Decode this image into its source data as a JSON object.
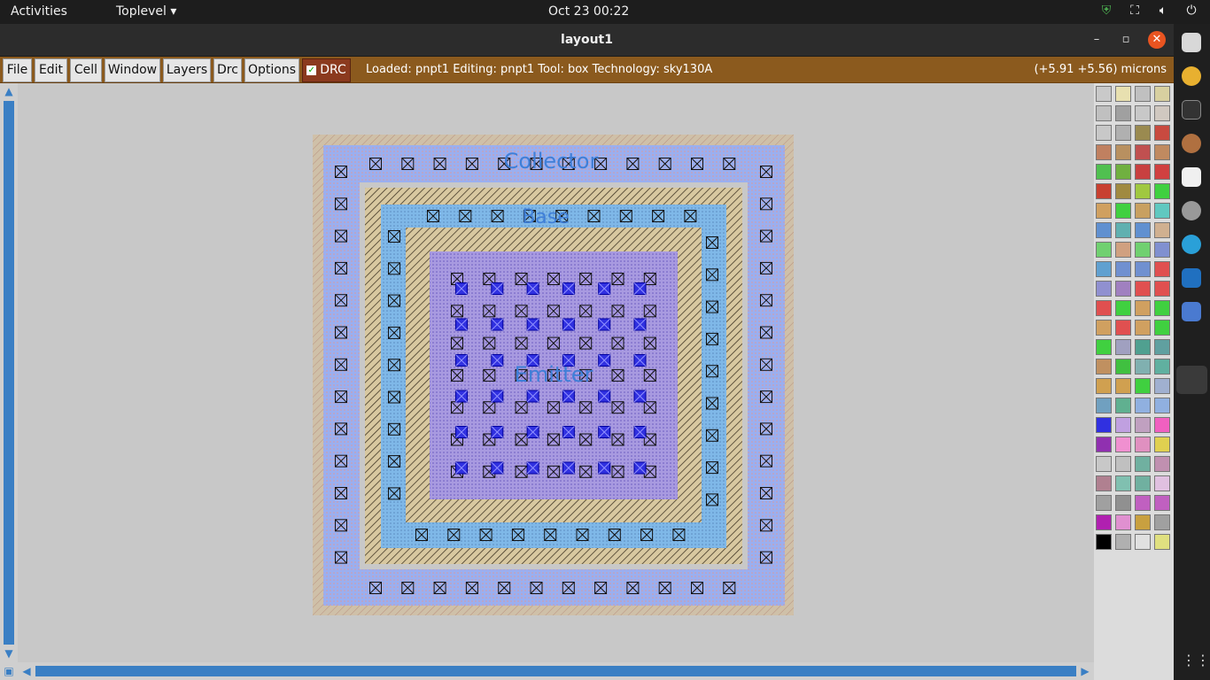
{
  "topbar": {
    "activities": "Activities",
    "app_menu": "Toplevel ▾",
    "clock": "Oct 23  00:22"
  },
  "window": {
    "title": "layout1"
  },
  "menubar": {
    "items": [
      "File",
      "Edit",
      "Cell",
      "Window",
      "Layers",
      "Drc",
      "Options"
    ],
    "drc_toggle": "DRC",
    "drc_checked": true,
    "status": "Loaded: pnpt1 Editing: pnpt1 Tool: box  Technology: sky130A",
    "coords": "(+5.91 +5.56) microns"
  },
  "layout": {
    "labels": {
      "collector": "Collector",
      "base": "Base",
      "emitter": "Emitter"
    },
    "colors": {
      "background": "#c8c8c8",
      "nwell_fill": "#9aaff0",
      "base_ring": "#7fb8e8",
      "hatch": "#a08a5a",
      "emitter_fill": "#a89ae0",
      "contact_blue": "#1010d0",
      "label_text": "#3f7fd8"
    }
  },
  "palette": {
    "colors": [
      "#c9c9c9",
      "#e8e0b0",
      "#c0c0c0",
      "#d8d0a0",
      "#c0c0c0",
      "#a0a0a0",
      "#c8c8c8",
      "#d0c8c0",
      "#c8c8c8",
      "#b0b0b0",
      "#9a8a50",
      "#c84a40",
      "#c08060",
      "#b89060",
      "#c05050",
      "#c08a60",
      "#50c050",
      "#70b040",
      "#c84040",
      "#d04040",
      "#c84030",
      "#a08a40",
      "#a0c840",
      "#40d040",
      "#d0a060",
      "#40d040",
      "#c8a060",
      "#60c8c0",
      "#6090d0",
      "#60b0b0",
      "#6090d0",
      "#d0b090",
      "#70d070",
      "#d0a080",
      "#70d070",
      "#8090d0",
      "#60a0d0",
      "#7090d0",
      "#7090d0",
      "#e05050",
      "#9090d0",
      "#a080c0",
      "#e05050",
      "#e05050",
      "#e05050",
      "#40d040",
      "#d0a060",
      "#40d040",
      "#d0a060",
      "#e05050",
      "#d0a060",
      "#40d040",
      "#40d040",
      "#a0a0c0",
      "#50a090",
      "#60a0a0",
      "#c09060",
      "#40c040",
      "#80b0b0",
      "#60b0a0",
      "#d0a050",
      "#d0a050",
      "#40d040",
      "#a0b0d0",
      "#70a0c0",
      "#60b090",
      "#90b0e0",
      "#90b0e0",
      "#3030e0",
      "#c0a0e0",
      "#c0a0c0",
      "#f060c0",
      "#9030b0",
      "#f090d0",
      "#e090c0",
      "#e0d050",
      "#c8c8c8",
      "#c0c0c0",
      "#70b0a0",
      "#c090b0",
      "#b08090",
      "#80c0b0",
      "#70b0a0",
      "#e0c0e0",
      "#a0a0a0",
      "#909090",
      "#c060c0",
      "#c060c0",
      "#b020b0",
      "#e090d0",
      "#c8a040",
      "#a0a0a0",
      "#000000",
      "#b0b0b0",
      "#e0e0e0",
      "#e0e080"
    ]
  },
  "dock": {
    "icons": [
      "files-icon",
      "chrome-icon",
      "terminal-icon",
      "app-icon",
      "notes-icon",
      "settings-icon",
      "telegram-icon",
      "vscode-icon",
      "screenshot-icon",
      "active-app-icon",
      "apps-grid-icon"
    ]
  }
}
